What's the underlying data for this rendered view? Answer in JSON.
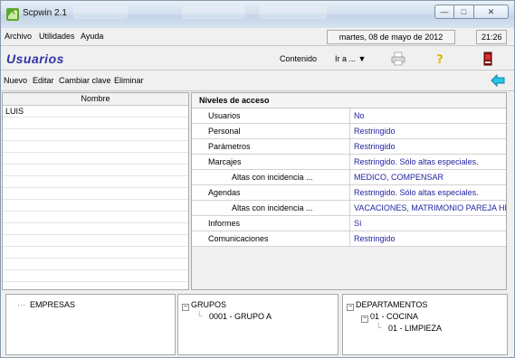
{
  "window": {
    "title": "Scpwin 2.1",
    "minimize_symbol": "—",
    "maximize_symbol": "□",
    "close_symbol": "✕"
  },
  "menu": {
    "archivo": "Archivo",
    "utilidades": "Utilidades",
    "ayuda": "Ayuda",
    "date": "martes, 08 de mayo de 2012",
    "time": "21:26"
  },
  "header": {
    "section": "Usuarios",
    "contenido": "Contenido",
    "ir_a": "Ir a ... ▼"
  },
  "toolbar": {
    "nuevo": "Nuevo",
    "editar": "Editar",
    "cambiar_clave": "Cambiar clave",
    "eliminar": "Eliminar"
  },
  "users": {
    "header": "Nombre",
    "rows": [
      "LUIS"
    ]
  },
  "access": {
    "header": "Niveles de acceso",
    "rows": [
      {
        "label": "Usuarios",
        "value": "No"
      },
      {
        "label": "Personal",
        "value": "Restringido"
      },
      {
        "label": "Parámetros",
        "value": "Restringido"
      },
      {
        "label": "Marcajes",
        "value": "Restringido. Sólo altas especiales."
      },
      {
        "label": "Altas con incidencia ...",
        "value": "MEDICO, COMPENSAR"
      },
      {
        "label": "Agendas",
        "value": "Restringido. Sólo altas especiales."
      },
      {
        "label": "Altas con incidencia ...",
        "value": "VACACIONES, MATRIMONIO PAREJA HE"
      },
      {
        "label": "Informes",
        "value": "Sí"
      },
      {
        "label": "Comunicaciones",
        "value": "Restringido"
      }
    ]
  },
  "panels": {
    "empresas": "EMPRESAS",
    "grupos": "GRUPOS",
    "grupo_a": "0001 - GRUPO A",
    "departamentos": "DEPARTAMENTOS",
    "cocina": "01 - COCINA",
    "limpieza": "01 - LIMPIEZA",
    "expanded_symbol": "−"
  },
  "colors": {
    "section_title": "#3232a8",
    "access_value": "#1f1fa0",
    "back_arrow": "#29c4e8"
  }
}
